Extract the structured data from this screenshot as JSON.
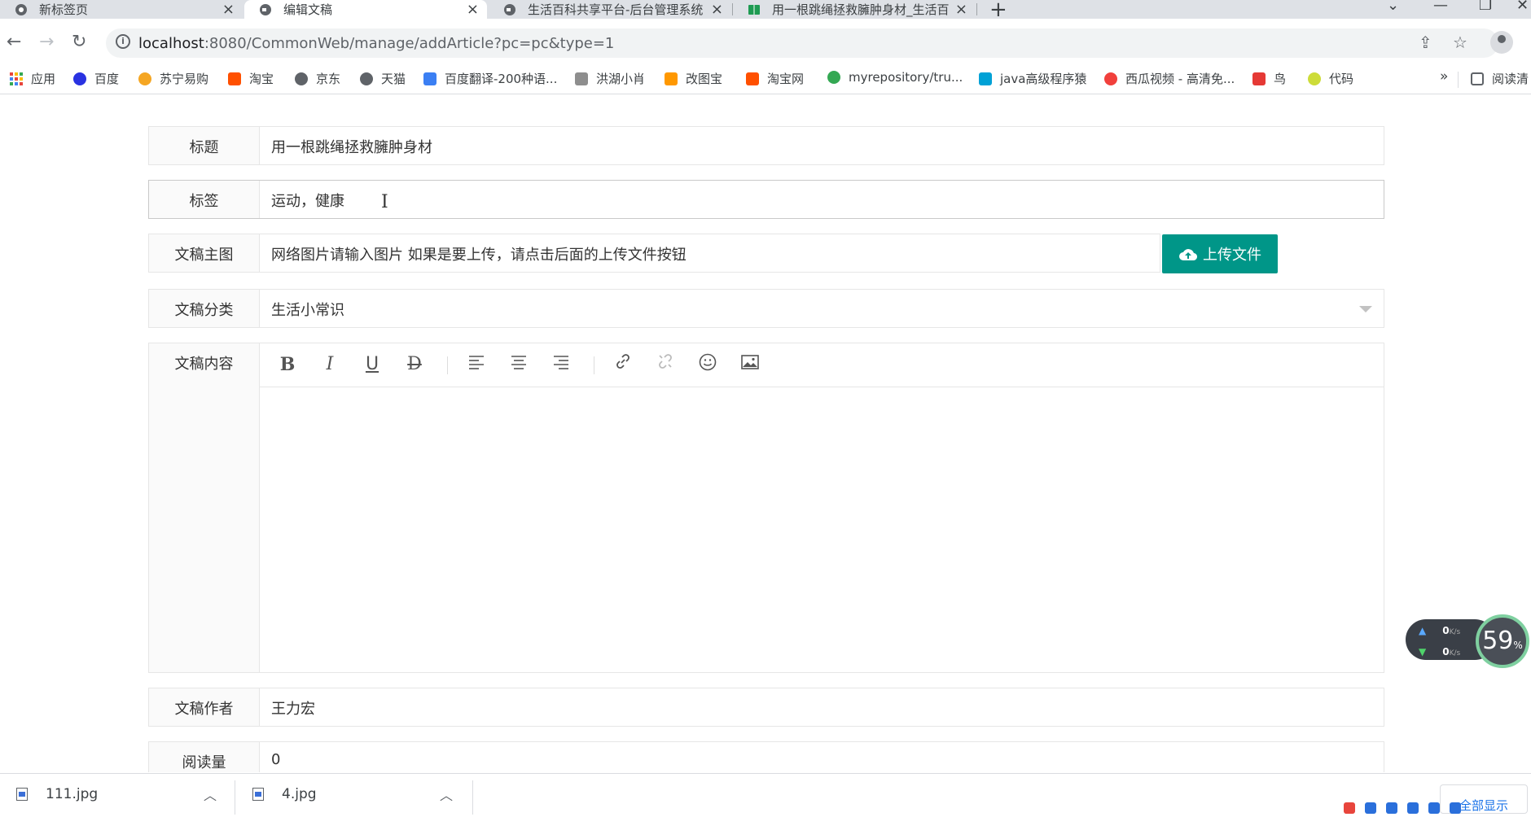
{
  "browser": {
    "tabs": [
      {
        "title": "新标签页"
      },
      {
        "title": "编辑文稿"
      },
      {
        "title": "生活百科共享平台-后台管理系统"
      },
      {
        "title": "用一根跳绳拯救臃肿身材_生活百"
      }
    ],
    "url": {
      "host": "localhost",
      "rest": ":8080/CommonWeb/manage/addArticle?pc=pc&type=1"
    },
    "bookmarks": [
      {
        "label": "应用",
        "color": "#e8453c"
      },
      {
        "label": "百度",
        "color": "#2932e1"
      },
      {
        "label": "苏宁易购",
        "color": "#f5a623"
      },
      {
        "label": "淘宝",
        "color": "#ff5000"
      },
      {
        "label": "京东",
        "color": "#5f6368"
      },
      {
        "label": "天猫",
        "color": "#5f6368"
      },
      {
        "label": "百度翻译-200种语...",
        "color": "#3b7ff3"
      },
      {
        "label": "洪湖小肖",
        "color": "#8e8e8e"
      },
      {
        "label": "改图宝",
        "color": "#ff9800"
      },
      {
        "label": "淘宝网",
        "color": "#ff5000"
      },
      {
        "label": "myrepository/tru...",
        "color": "#34a853"
      },
      {
        "label": "java高级程序猿",
        "color": "#00a1d6"
      },
      {
        "label": "西瓜视频 - 高清免...",
        "color": "#f1403c"
      },
      {
        "label": "鸟",
        "color": "#e53935"
      },
      {
        "label": "代码",
        "color": "#cddc39"
      },
      {
        "label": "阅读清",
        "color": "#5f6368"
      }
    ],
    "bookmarks_more": "»"
  },
  "form": {
    "title": {
      "label": "标题",
      "value": "用一根跳绳拯救臃肿身材"
    },
    "tags": {
      "label": "标签",
      "value": "运动，健康"
    },
    "cover": {
      "label": "文稿主图",
      "placeholder": "网络图片请输入图片 如果是要上传，请点击后面的上传文件按钮",
      "upload_label": "上传文件"
    },
    "category": {
      "label": "文稿分类",
      "value": "生活小常识"
    },
    "content": {
      "label": "文稿内容",
      "value": ""
    },
    "author": {
      "label": "文稿作者",
      "value": "王力宏"
    },
    "views": {
      "label": "阅读量",
      "value": "0"
    }
  },
  "editor_toolbar": [
    "bold-icon",
    "italic-icon",
    "underline-icon",
    "strikethrough-icon",
    "align-left-icon",
    "align-center-icon",
    "align-right-icon",
    "link-icon",
    "unlink-icon",
    "emoji-icon",
    "image-icon"
  ],
  "net_widget": {
    "up": "0",
    "down": "0",
    "unit": "K/s",
    "percent": "59",
    "percent_sign": "%"
  },
  "downloads": [
    {
      "name": "111.jpg"
    },
    {
      "name": "4.jpg"
    }
  ],
  "show_all": "全部显示",
  "colors": {
    "accent": "#009688",
    "border": "#e6e6e6",
    "label_bg": "#fafafa"
  }
}
